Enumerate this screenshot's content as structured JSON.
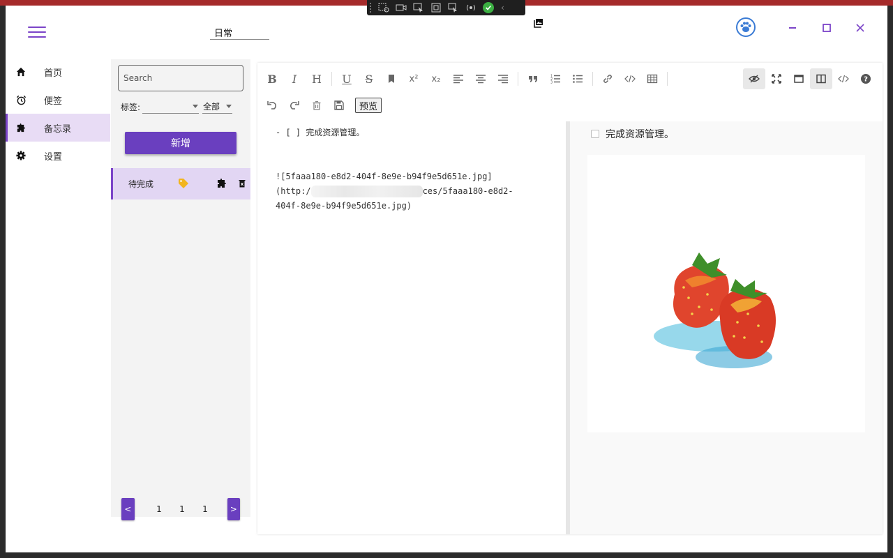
{
  "window": {
    "title_field": "日常"
  },
  "nav": {
    "items": [
      {
        "label": "首页",
        "icon": "home-icon"
      },
      {
        "label": "便签",
        "icon": "alarm-icon"
      },
      {
        "label": "备忘录",
        "icon": "puzzle-icon",
        "active": true
      },
      {
        "label": "设置",
        "icon": "gear-icon"
      }
    ]
  },
  "list": {
    "search_placeholder": "Search",
    "tag_label": "标签:",
    "tag_value": "",
    "filter_value": "全部",
    "add_button": "新增",
    "items": [
      {
        "title": "待完成"
      }
    ],
    "pager": {
      "prev": "<",
      "next": ">",
      "nums": [
        "1",
        "1",
        "1"
      ]
    }
  },
  "editor": {
    "preview_button": "预览",
    "markdown": {
      "line1": "- [ ] 完成资源管理。",
      "line2": "![5faaa180-e8d2-404f-8e9e-b94f9e5d651e.jpg]",
      "line3_prefix": "(http:/",
      "line3_suffix": "ces/5faaa180-e8d2-",
      "line4": "404f-8e9e-b94f9e5d651e.jpg)"
    },
    "preview": {
      "task_text": "完成资源管理。",
      "image_subject": "strawberries"
    }
  },
  "colors": {
    "accent": "#6a3fbf",
    "accent_light": "#e2d6f3",
    "frame": "#a52a2a"
  }
}
